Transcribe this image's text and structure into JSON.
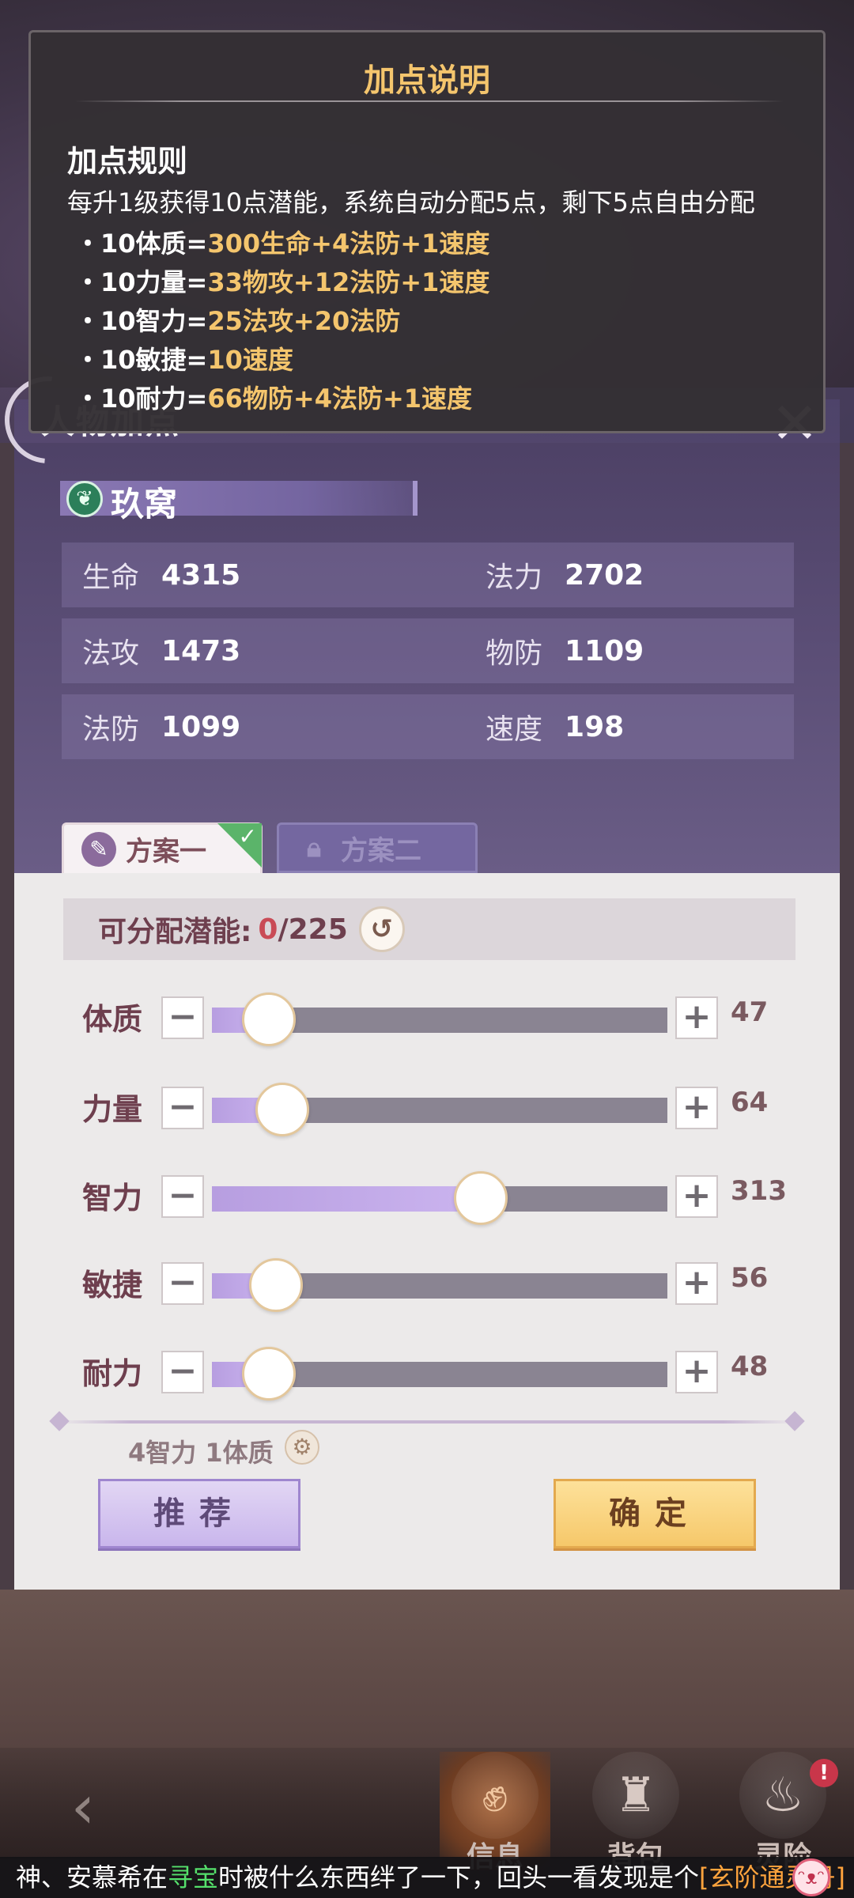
{
  "tooltip": {
    "title": "加点说明",
    "subtitle": "加点规则",
    "description": "每升1级获得10点潜能，系统自动分配5点，剩下5点自由分配",
    "rules": [
      {
        "prefix": "・10体质=",
        "effect": "300生命+4法防+1速度"
      },
      {
        "prefix": "・10力量=",
        "effect": "33物攻+12法防+1速度"
      },
      {
        "prefix": "・10智力=",
        "effect": "25法攻+20法防"
      },
      {
        "prefix": "・10敏捷=",
        "effect": "10速度"
      },
      {
        "prefix": "・10耐力=",
        "effect": "66物防+4法防+1速度"
      }
    ]
  },
  "panel": {
    "title": "人物加点",
    "close_icon": "close-x-icon"
  },
  "character": {
    "name": "玖窝",
    "stats": [
      {
        "label": "生命",
        "value": "4315"
      },
      {
        "label": "法力",
        "value": "2702"
      },
      {
        "label": "法攻",
        "value": "1473"
      },
      {
        "label": "物防",
        "value": "1109"
      },
      {
        "label": "法防",
        "value": "1099"
      },
      {
        "label": "速度",
        "value": "198"
      }
    ]
  },
  "tabs": [
    {
      "label": "方案一",
      "active": true,
      "icon": "brush-icon"
    },
    {
      "label": "方案二",
      "active": false,
      "icon": "lock-icon"
    }
  ],
  "allocation": {
    "label": "可分配潜能:",
    "used": "0",
    "total": "/225",
    "reset_icon": "reset-icon"
  },
  "attributes": [
    {
      "label": "体质",
      "value": "47",
      "fill_fraction": 0.125
    },
    {
      "label": "力量",
      "value": "64",
      "fill_fraction": 0.155
    },
    {
      "label": "智力",
      "value": "313",
      "fill_fraction": 0.59
    },
    {
      "label": "敏捷",
      "value": "56",
      "fill_fraction": 0.14
    },
    {
      "label": "耐力",
      "value": "48",
      "fill_fraction": 0.125
    }
  ],
  "recommendation": {
    "text": "4智力 1体质"
  },
  "buttons": {
    "recommend": "推荐",
    "confirm": "确定"
  },
  "bottom_nav": [
    {
      "label": "信息",
      "icon": "fist-icon",
      "active": true
    },
    {
      "label": "背包",
      "icon": "bag-icon",
      "active": false
    },
    {
      "label": "灵险",
      "icon": "flame-icon",
      "active": false
    }
  ],
  "nav_badge": "!",
  "ticker": {
    "part1": "神、安慕希在",
    "part2": "寻宝",
    "part3": "时被什么东西绊了一下，回头一看发现是个",
    "part4": "[玄阶通灵丹]"
  },
  "colors": {
    "highlight": "#f4c56d",
    "accent_text": "#6e3f4e",
    "used_points": "#c94b56",
    "slider_fill": "#b79ee0"
  }
}
